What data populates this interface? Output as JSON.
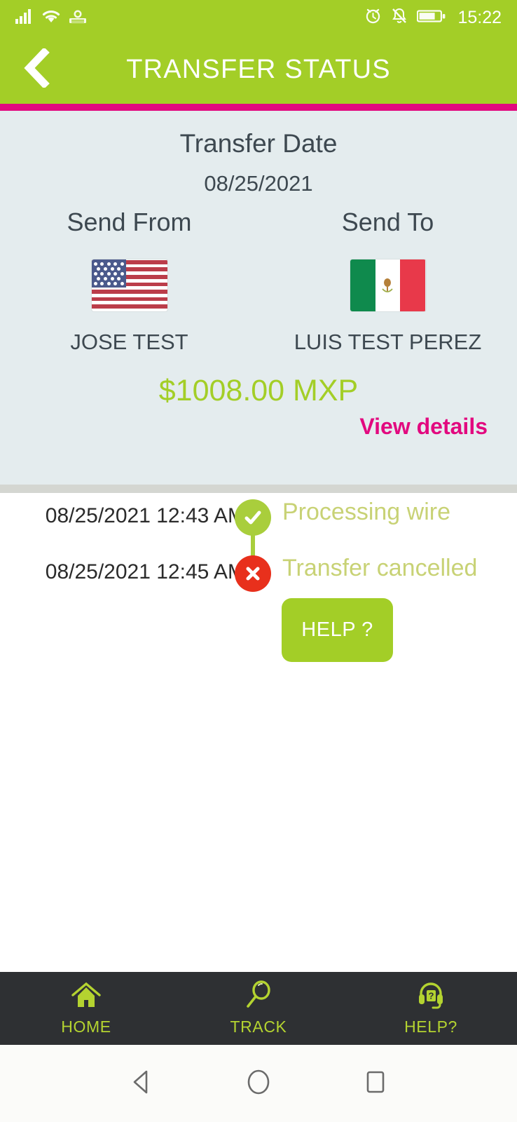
{
  "statusbar": {
    "time": "15:22",
    "left_icons": [
      "signal-bars-icon",
      "wifi-icon",
      "data-sync-icon"
    ],
    "right_icons": [
      "alarm-clock-icon",
      "bell-muted-icon",
      "battery-icon"
    ]
  },
  "appbar": {
    "title": "TRANSFER STATUS",
    "back_icon": "chevron-left-icon",
    "bg_color": "#a3ce27",
    "accent_color": "#e2097f"
  },
  "card": {
    "date_label": "Transfer Date",
    "date_value": "08/25/2021",
    "send_from_label": "Send From",
    "send_to_label": "Send To",
    "sender_name": "JOSE TEST",
    "recipient_name": "LUIS TEST PEREZ",
    "sender_flag": "flag-united-states-icon",
    "recipient_flag": "flag-mexico-icon",
    "amount": "$1008.00 MXP",
    "amount_color": "#a3ce27",
    "view_details_label": "View details",
    "view_details_color": "#e2097f"
  },
  "timeline": {
    "events": [
      {
        "timestamp": "08/25/2021 12:43 AM",
        "label": "Processing wire",
        "icon": "check-circle-icon",
        "status": "ok",
        "icon_color": "#a9ce3c"
      },
      {
        "timestamp": "08/25/2021 12:45 AM",
        "label": "Transfer cancelled",
        "icon": "x-circle-icon",
        "status": "bad",
        "icon_color": "#e8301c"
      }
    ],
    "label_color": "#c8d275"
  },
  "help_button": {
    "label": "HELP ?"
  },
  "bottomnav": {
    "items": [
      {
        "label": "HOME",
        "icon": "home-icon"
      },
      {
        "label": "TRACK",
        "icon": "magnifier-icon"
      },
      {
        "label": "HELP?",
        "icon": "headset-question-icon"
      }
    ],
    "accent_color": "#b4d330",
    "bg_color": "#2e3033"
  },
  "sysnav": {
    "buttons": [
      {
        "name": "back-icon"
      },
      {
        "name": "home-circle-icon"
      },
      {
        "name": "recents-square-icon"
      }
    ]
  }
}
